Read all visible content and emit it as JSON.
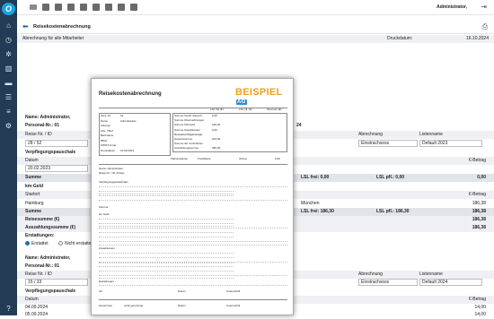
{
  "app": {
    "user": "Administrator,",
    "page_title": "Reisekostenabrechnung",
    "subtitle": "Abrechnung für alle Mitarbeiter",
    "print_date_label": "Druckdatum:",
    "print_date": "16.10.2024"
  },
  "bg": {
    "name_label": "Name: Administrator,",
    "personal_label": "Personal-Nr.: 01",
    "right_num": "24",
    "reise_label": "Reise Nr. / ID",
    "reise_val": "28 / 52",
    "abrechnung_hdr": "Abrechnung",
    "listenname_hdr": "Listenname",
    "abrechnung_val": "Einstrachsoss",
    "listen_val": "Default 2023",
    "verpflegung": "Verpflegungspauschale",
    "datum_hdr": "Datum",
    "betrag_hdr": "€-Betrag",
    "datum_val": "20.02.2023",
    "summe": "Summe",
    "lsl_frei": "LSL frei: 0,00",
    "lsl_pfl": "LSL pfl.: 0,00",
    "null": "0,00",
    "kmgeld": "km-Geld",
    "startort": "Startort",
    "start_val": "Hamburg",
    "muenchen": "München",
    "betrag_val": "186,38",
    "summe2": "Summe",
    "lsl_frei2": "LSL frei: 186,30",
    "lsl_pfl2": "LSL pfl.: 186,30",
    "reisesumme": "Reisesumme (€)",
    "auszahl": "Auszahlungssumme (€)",
    "erstatt": "Erstattungen:",
    "erstattet": "Erstattet",
    "nicht": "Nicht erstattet",
    "name2": "Name: Administrator,",
    "personal2": "Personal-Nr.: 01",
    "reise2_val": "15 / 33",
    "listen2": "Default 2024",
    "verpflegung2": "Verpflegungspauschale",
    "datum2": "Datum",
    "d1": "04.09.2024",
    "d2": "05.09.2024",
    "v1": "14,00",
    "v2": "14,00",
    "summe3": "Summe"
  },
  "doc": {
    "title": "Reisekostenabrechnung",
    "logo": "BEISPIEL",
    "logo_ag": "AG",
    "cols": [
      "LSL frei (€)",
      "LSL pfl. (€)",
      "Summen (€)"
    ],
    "left": [
      "Pers.-Nr.",
      "Name",
      "Adresse",
      "Abs. / BLZ",
      "Bankname",
      "IBAN",
      "SWIFT-Code",
      "Druckdatum"
    ],
    "left_vals": [
      "01",
      "Administrator",
      "",
      "",
      "",
      "",
      "",
      "16.09.2024"
    ],
    "mid": [
      "Summe Verpfl.-Pausch.",
      "Summe Übernachtungen",
      "Summe KM-Geld",
      "Summe Zusatzkosten",
      "Reiseabschlagsbeträge",
      "Gesamtsumme",
      "Summe der Vorschüsse",
      "Auszahlungssumme"
    ],
    "mid_vals": [
      "0,00",
      "",
      "226,00",
      "0,00",
      "",
      "224,00",
      "",
      "280,00"
    ],
    "zahl": "Zahlungsarten",
    "kredit": "Kreditkarte",
    "abzug": "Abzug",
    "abzug_val": "0,00",
    "sec_name": "Name: Administrator",
    "sec_reise": "Reise-Nr. / ID: Anlass",
    "sec_verpf": "Verpflegungspauschalen",
    "sec_sum": "Summe",
    "sec_km": "km-Geld",
    "sec_zusatz": "Zusatzkosten",
    "sec_erst": "Erstattungen",
    "sig1": "Ort",
    "sig2": "Datum",
    "sig3": "Unterschrift",
    "gen": "Genehmigt",
    "ngen": "nicht genehmigt",
    "sig4": "Datum",
    "sig5": "Unterschrift"
  }
}
